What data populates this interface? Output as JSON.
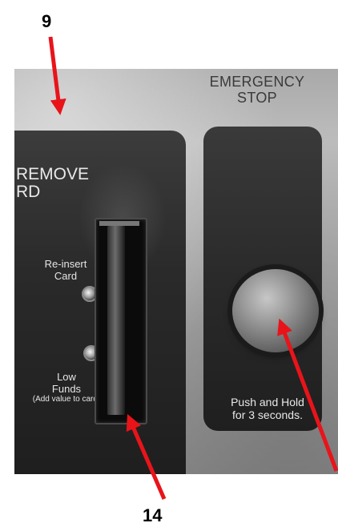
{
  "callouts": {
    "top_number": "9",
    "bottom_number": "14"
  },
  "panel": {
    "emergency_header": "EMERGENCY STOP",
    "emergency_header_line1": "EMERGENCY",
    "emergency_header_line2": "STOP",
    "remove_card_line1": "REMOVE",
    "remove_card_line2": "RD",
    "reinsert_label_line1": "Re-insert",
    "reinsert_label_line2": "Card",
    "low_funds_line1": "Low",
    "low_funds_line2": "Funds",
    "low_funds_line3": "(Add value to card)",
    "instructions_line1": "Push and Hold",
    "instructions_line2": "for 3 seconds."
  },
  "colors": {
    "arrow": "#e8141a",
    "panel_dark": "#2a2a2a",
    "plate_gray": "#b1b1b1"
  }
}
